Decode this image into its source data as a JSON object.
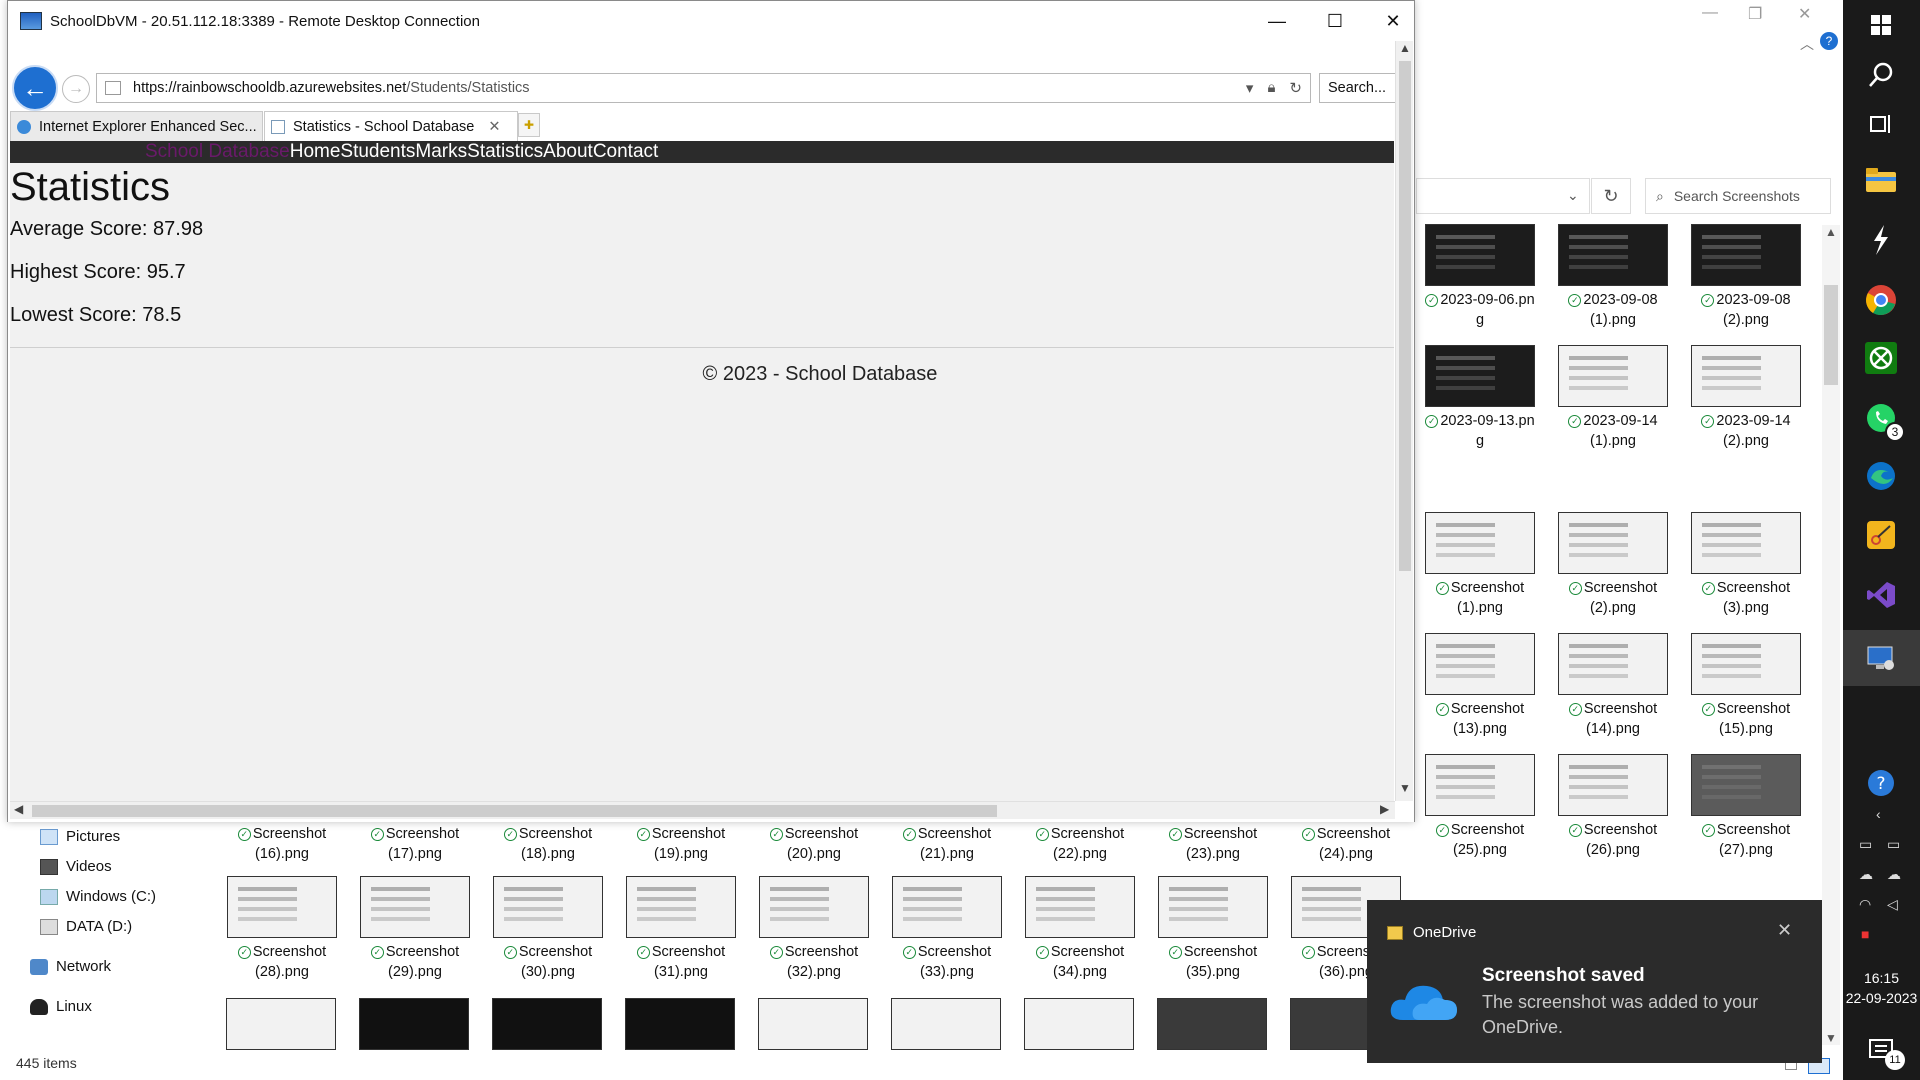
{
  "rdp": {
    "title": "SchoolDbVM - 20.51.112.18:3389 - Remote Desktop Connection",
    "minimize": "—",
    "maximize": "☐",
    "close": "✕"
  },
  "browser": {
    "url_host": "https://rainbowschooldb.azurewebsites.net",
    "url_path": "/Students/Statistics",
    "search_placeholder": "Search...",
    "back": "←",
    "forward": "→",
    "tabs": [
      {
        "label": "Internet Explorer Enhanced Sec..."
      },
      {
        "label": "Statistics - School Database",
        "close": "✕"
      }
    ]
  },
  "site": {
    "brand": "School Database",
    "nav": [
      "Home",
      "Students",
      "Marks",
      "Statistics",
      "About",
      "Contact"
    ],
    "page_title": "Statistics",
    "stats": [
      "Average Score: 87.98",
      "Highest Score: 95.7",
      "Lowest Score: 78.5"
    ],
    "footer": "© 2023 - School Database"
  },
  "explorer": {
    "search_placeholder": "Search Screenshots",
    "item_count": "445 items",
    "nav_items": [
      "Pictures",
      "Videos",
      "Windows (C:)",
      "DATA (D:)",
      "Network",
      "Linux"
    ],
    "files_right": [
      [
        "2023-09-06.pn g",
        "2023-09-08 (1).png",
        "2023-09-08 (2).png"
      ],
      [
        "2023-09-13.pn g",
        "2023-09-14 (1).png",
        "2023-09-14 (2).png"
      ],
      [
        "Screenshot (1).png",
        "Screenshot (2).png",
        "Screenshot (3).png"
      ],
      [
        "Screenshot (13).png",
        "Screenshot (14).png",
        "Screenshot (15).png"
      ],
      [
        "Screenshot (25).png",
        "Screenshot (26).png",
        "Screenshot (27).png"
      ]
    ],
    "row_16_24": [
      "Screenshot (16).png",
      "Screenshot (17).png",
      "Screenshot (18).png",
      "Screenshot (19).png",
      "Screenshot (20).png",
      "Screenshot (21).png",
      "Screenshot (22).png",
      "Screenshot (23).png",
      "Screenshot (24).png"
    ],
    "row_28_36": [
      "Screenshot (28).png",
      "Screenshot (29).png",
      "Screenshot (30).png",
      "Screenshot (31).png",
      "Screenshot (32).png",
      "Screenshot (33).png",
      "Screenshot (34).png",
      "Screenshot (35).png",
      "Screenshot (36).png"
    ]
  },
  "toast": {
    "app": "OneDrive",
    "title": "Screenshot saved",
    "body": "The screenshot was added to your OneDrive.",
    "close": "✕"
  },
  "taskbar": {
    "time": "16:15",
    "date": "22-09-2023",
    "whatsapp_badge": "3",
    "notif_badge": "11",
    "icons": [
      "windows-start-icon",
      "search-icon",
      "task-view-icon",
      "file-explorer-icon",
      "terminal-icon",
      "chrome-icon",
      "xbox-icon",
      "whatsapp-icon",
      "edge-icon",
      "snipping-tool-icon",
      "visual-studio-icon",
      "remote-desktop-icon",
      "help-icon"
    ]
  },
  "colors": {
    "ie_back": "#1e6fd1",
    "navbar": "#2b2b2b",
    "brand_link": "#6a1a6a",
    "toast_bg": "#2b2b2b",
    "taskbar_bg": "#1a1a1a"
  }
}
